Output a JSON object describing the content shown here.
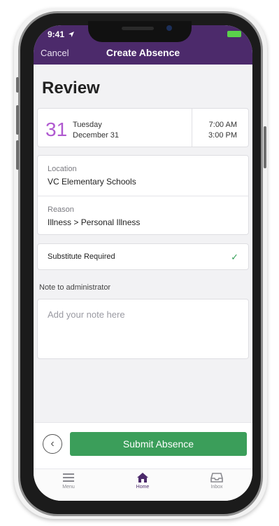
{
  "status_bar": {
    "time": "9:41"
  },
  "nav": {
    "cancel_label": "Cancel",
    "title": "Create Absence"
  },
  "page": {
    "heading": "Review"
  },
  "date_card": {
    "day_number": "31",
    "weekday": "Tuesday",
    "date": "December 31",
    "start_time": "7:00 AM",
    "end_time": "3:00 PM"
  },
  "details": {
    "location_label": "Location",
    "location_value": "VC Elementary Schools",
    "reason_label": "Reason",
    "reason_value": "Illness > Personal Illness"
  },
  "substitute": {
    "label": "Substitute Required",
    "checked": true
  },
  "note": {
    "label": "Note to administrator",
    "placeholder": "Add your note here",
    "value": ""
  },
  "actions": {
    "submit_label": "Submit Absence"
  },
  "tabs": [
    {
      "label": "Menu",
      "icon": "menu-icon",
      "active": false
    },
    {
      "label": "Home",
      "icon": "home-icon",
      "active": true
    },
    {
      "label": "Inbox",
      "icon": "inbox-icon",
      "active": false
    }
  ],
  "colors": {
    "header": "#4c2a6b",
    "accent_date": "#b05ad0",
    "submit": "#3b9e5a",
    "check": "#35a058"
  }
}
